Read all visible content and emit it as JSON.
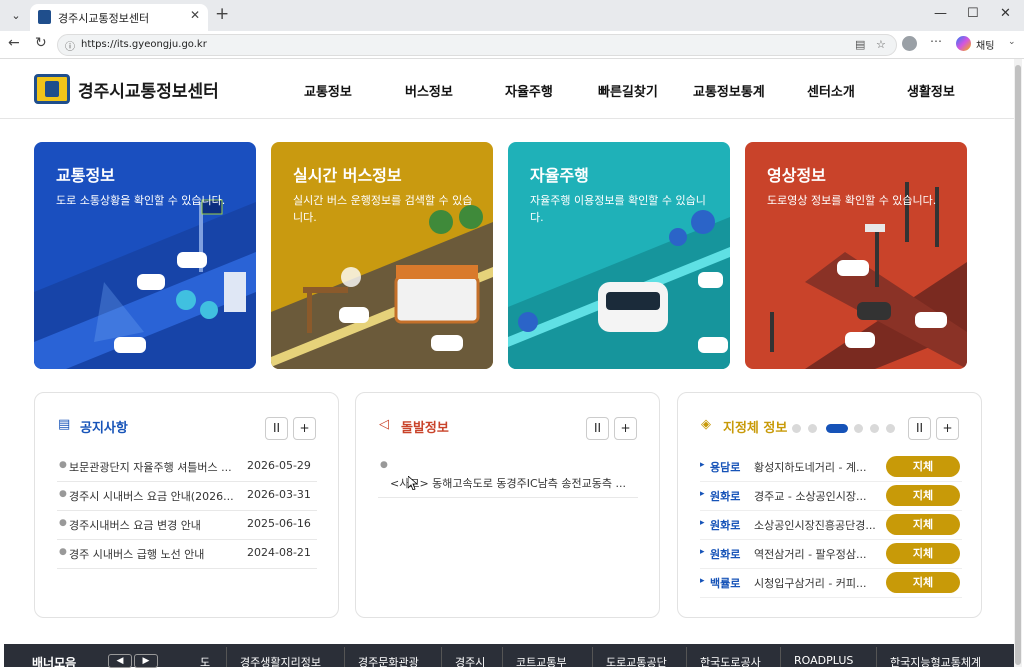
{
  "browser": {
    "tab_title": "경주시교통정보센터",
    "url": "https://its.gyeongju.go.kr",
    "chat_label": "채팅"
  },
  "header": {
    "logo": "경주시교통정보센터",
    "nav": [
      "교통정보",
      "버스정보",
      "자율주행",
      "빠른길찾기",
      "교통정보통계",
      "센터소개",
      "생활정보"
    ]
  },
  "cards": [
    {
      "title": "교통정보",
      "desc": "도로 소통상황을 확인할 수 있습니다.",
      "color": "#1a4fbf"
    },
    {
      "title": "실시간 버스정보",
      "desc": "실시간 버스 운행정보를 검색할 수 있습니다.",
      "color": "#c99a10"
    },
    {
      "title": "자율주행",
      "desc": "자율주행 이용정보를 확인할 수 있습니다.",
      "color": "#1fb1b8"
    },
    {
      "title": "영상정보",
      "desc": "도로영상 정보를 확인할 수 있습니다.",
      "color": "#c9432a"
    }
  ],
  "notice": {
    "title": "공지사항",
    "items": [
      {
        "title": "보문관광단지 자율주행 셔틀버스 ...",
        "date": "2026-05-29"
      },
      {
        "title": "경주시 시내버스 요금 안내(2026...",
        "date": "2026-03-31"
      },
      {
        "title": "경주시내버스 요금 변경 안내",
        "date": "2025-06-16"
      },
      {
        "title": "경주 시내버스 급행 노선 안내",
        "date": "2024-08-21"
      }
    ]
  },
  "incident": {
    "title": "돌발정보",
    "items": [
      "<사고> 동해고속도로 동경주IC남측 송전교동측 ..."
    ]
  },
  "congestion": {
    "title": "지정체 정보",
    "items": [
      {
        "road": "용담로",
        "section": "황성지하도네거리 - 계...",
        "status": "지체"
      },
      {
        "road": "원화로",
        "section": "경주교 - 소상공인시장...",
        "status": "지체"
      },
      {
        "road": "원화로",
        "section": "소상공인시장진흥공단경...",
        "status": "지체"
      },
      {
        "road": "원화로",
        "section": "역전삼거리 - 팔우정삼...",
        "status": "지체"
      },
      {
        "road": "백률로",
        "section": "시청입구삼거리 - 커피...",
        "status": "지체"
      }
    ]
  },
  "controls": {
    "pause": "II",
    "plus": "+"
  },
  "banner": {
    "title": "배너모음",
    "links": [
      "도",
      "경주생활지리정보",
      "경주문화관광",
      "경주시",
      "코트교통부",
      "도로교통공단",
      "한국도로공사",
      "ROADPLUS",
      "한국지능형교통체계"
    ]
  }
}
